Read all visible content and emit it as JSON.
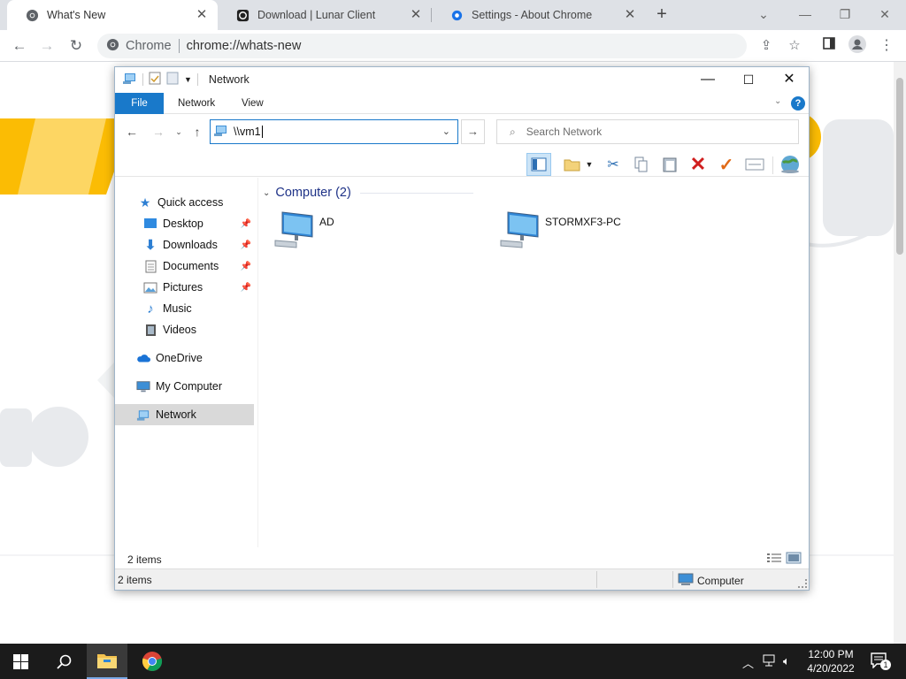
{
  "browser": {
    "tabs": [
      {
        "title": "What's New",
        "active": true
      },
      {
        "title": "Download | Lunar Client",
        "active": false
      },
      {
        "title": "Settings - About Chrome",
        "active": false
      }
    ],
    "omnibox": {
      "site": "Chrome",
      "url": "chrome://whats-new"
    }
  },
  "explorer": {
    "window_title": "Network",
    "ribbon_tabs": [
      "File",
      "Network",
      "View"
    ],
    "address_value": "\\\\vm1",
    "search_placeholder": "Search Network",
    "nav": {
      "quick_access": "Quick access",
      "items": [
        "Desktop",
        "Downloads",
        "Documents",
        "Pictures",
        "Music",
        "Videos"
      ],
      "onedrive": "OneDrive",
      "my_computer": "My Computer",
      "network": "Network"
    },
    "group_header": "Computer (2)",
    "computers": [
      "AD",
      "STORMXF3-PC"
    ],
    "item_count": "2 items",
    "status_count": "2 items",
    "status_location": "Computer"
  },
  "taskbar": {
    "time": "12:00 PM",
    "date": "4/20/2022",
    "notification_count": "1"
  },
  "colors": {
    "accent": "#1979ca",
    "group_header": "#1e3287",
    "page_yellow": "#fbbc04"
  }
}
